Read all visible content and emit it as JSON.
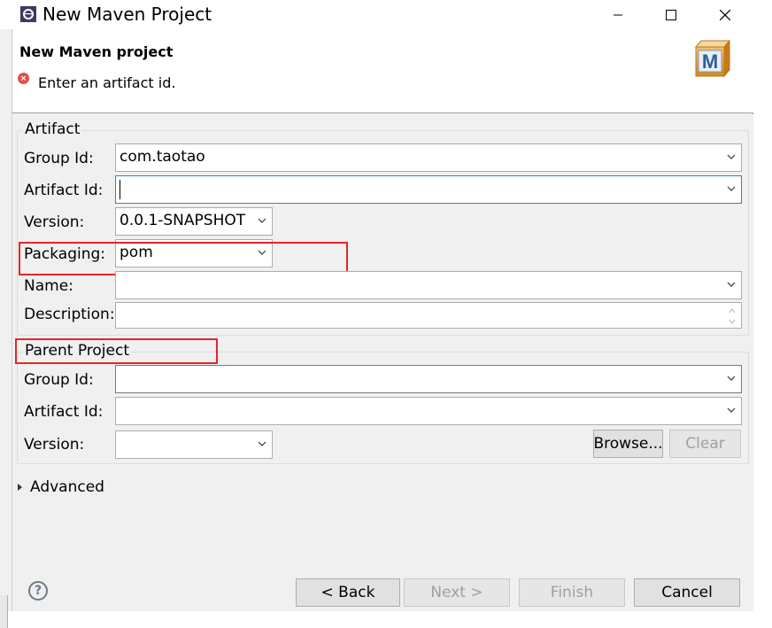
{
  "window": {
    "title": "New Maven Project",
    "controls": {
      "minimize": "minimize",
      "maximize": "maximize",
      "close": "close"
    }
  },
  "header": {
    "title": "New Maven project",
    "message": "Enter an artifact id.",
    "message_type": "error"
  },
  "artifact": {
    "section_title": "Artifact",
    "group_id": {
      "label": "Group Id:",
      "value": "com.taotao"
    },
    "artifact_id": {
      "label": "Artifact Id:",
      "value": ""
    },
    "version": {
      "label": "Version:",
      "value": "0.0.1-SNAPSHOT"
    },
    "packaging": {
      "label": "Packaging:",
      "value": "pom"
    },
    "name": {
      "label": "Name:",
      "value": ""
    },
    "description": {
      "label": "Description:",
      "value": ""
    }
  },
  "parent": {
    "section_title": "Parent Project",
    "group_id": {
      "label": "Group Id:",
      "value": ""
    },
    "artifact_id": {
      "label": "Artifact Id:",
      "value": ""
    },
    "version": {
      "label": "Version:",
      "value": ""
    },
    "browse_label": "Browse...",
    "clear_label": "Clear"
  },
  "advanced": {
    "label": "Advanced"
  },
  "footer": {
    "back_label": "< Back",
    "next_label": "Next >",
    "finish_label": "Finish",
    "cancel_label": "Cancel"
  },
  "colors": {
    "highlight_box": "#e5262a",
    "focus_border": "#3c7fb1",
    "error_icon": "#d9534f"
  }
}
